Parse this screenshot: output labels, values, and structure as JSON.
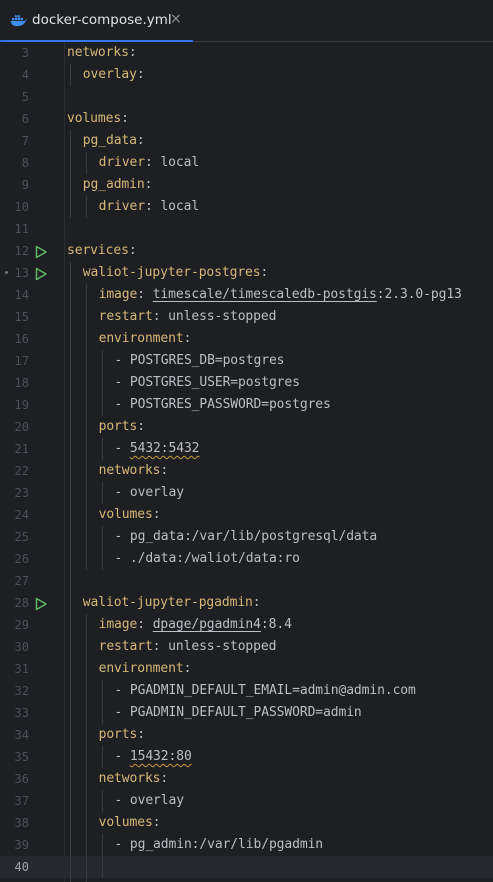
{
  "tab": {
    "title": "docker-compose.yml",
    "close": "×"
  },
  "colors": {
    "accent": "#3574f0",
    "key": "#d5b778",
    "text": "#bcbec4",
    "run_icon": "#5fb865",
    "docker_icon": "#3f8ef0"
  },
  "editor": {
    "current_line": 40,
    "lines": [
      {
        "n": "3",
        "indent": 0,
        "key": "networks",
        "val": ""
      },
      {
        "n": "4",
        "indent": 2,
        "key": "overlay",
        "val": ""
      },
      {
        "n": "5",
        "indent": 0,
        "key": "",
        "val": ""
      },
      {
        "n": "6",
        "indent": 0,
        "key": "volumes",
        "val": ""
      },
      {
        "n": "7",
        "indent": 2,
        "key": "pg_data",
        "val": ""
      },
      {
        "n": "8",
        "indent": 4,
        "key": "driver",
        "val": "local"
      },
      {
        "n": "9",
        "indent": 2,
        "key": "pg_admin",
        "val": ""
      },
      {
        "n": "10",
        "indent": 4,
        "key": "driver",
        "val": "local"
      },
      {
        "n": "11",
        "indent": 0,
        "key": "",
        "val": ""
      },
      {
        "n": "12",
        "indent": 0,
        "key": "services",
        "val": "",
        "run": true
      },
      {
        "n": "13",
        "indent": 2,
        "key": "waliot-jupyter-postgres",
        "val": "",
        "run": true
      },
      {
        "n": "14",
        "indent": 4,
        "key": "image",
        "val": "",
        "image": [
          "timescale/timescaledb-postgis",
          ":2.3.0-pg13"
        ]
      },
      {
        "n": "15",
        "indent": 4,
        "key": "restart",
        "val": "unless-stopped"
      },
      {
        "n": "16",
        "indent": 4,
        "key": "environment",
        "val": ""
      },
      {
        "n": "17",
        "indent": 6,
        "key": "",
        "item": "POSTGRES_DB=postgres"
      },
      {
        "n": "18",
        "indent": 6,
        "key": "",
        "item": "POSTGRES_USER=postgres"
      },
      {
        "n": "19",
        "indent": 6,
        "key": "",
        "item": "POSTGRES_PASSWORD=postgres"
      },
      {
        "n": "20",
        "indent": 4,
        "key": "ports",
        "val": ""
      },
      {
        "n": "21",
        "indent": 6,
        "key": "",
        "item": "5432:5432",
        "squig": true
      },
      {
        "n": "22",
        "indent": 4,
        "key": "networks",
        "val": ""
      },
      {
        "n": "23",
        "indent": 6,
        "key": "",
        "item": "overlay"
      },
      {
        "n": "24",
        "indent": 4,
        "key": "volumes",
        "val": ""
      },
      {
        "n": "25",
        "indent": 6,
        "key": "",
        "item": "pg_data:/var/lib/postgresql/data"
      },
      {
        "n": "26",
        "indent": 6,
        "key": "",
        "item": "./data:/waliot/data:ro"
      },
      {
        "n": "27",
        "indent": 0,
        "key": "",
        "val": ""
      },
      {
        "n": "28",
        "indent": 2,
        "key": "waliot-jupyter-pgadmin",
        "val": "",
        "run": true
      },
      {
        "n": "29",
        "indent": 4,
        "key": "image",
        "val": "",
        "image": [
          "dpage/pgadmin4",
          ":8.4"
        ]
      },
      {
        "n": "30",
        "indent": 4,
        "key": "restart",
        "val": "unless-stopped"
      },
      {
        "n": "31",
        "indent": 4,
        "key": "environment",
        "val": ""
      },
      {
        "n": "32",
        "indent": 6,
        "key": "",
        "item": "PGADMIN_DEFAULT_EMAIL=admin@admin.com"
      },
      {
        "n": "33",
        "indent": 6,
        "key": "",
        "item": "PGADMIN_DEFAULT_PASSWORD=admin"
      },
      {
        "n": "34",
        "indent": 4,
        "key": "ports",
        "val": ""
      },
      {
        "n": "35",
        "indent": 6,
        "key": "",
        "item": "15432:80",
        "squig": true
      },
      {
        "n": "36",
        "indent": 4,
        "key": "networks",
        "val": ""
      },
      {
        "n": "37",
        "indent": 6,
        "key": "",
        "item": "overlay"
      },
      {
        "n": "38",
        "indent": 4,
        "key": "volumes",
        "val": ""
      },
      {
        "n": "39",
        "indent": 6,
        "key": "",
        "item": "pg_admin:/var/lib/pgadmin"
      },
      {
        "n": "40",
        "indent": 0,
        "key": "",
        "val": ""
      }
    ]
  }
}
